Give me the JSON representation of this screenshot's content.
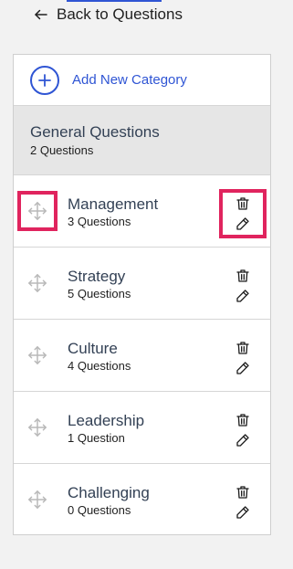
{
  "header": {
    "back_label": "Back to Questions"
  },
  "add_category": {
    "label": "Add New Category"
  },
  "general": {
    "title": "General Questions",
    "count": "2 Questions"
  },
  "categories": [
    {
      "title": "Management",
      "count": "3 Questions"
    },
    {
      "title": "Strategy",
      "count": "5 Questions"
    },
    {
      "title": "Culture",
      "count": "4 Questions"
    },
    {
      "title": "Leadership",
      "count": "1 Question"
    },
    {
      "title": "Challenging",
      "count": "0 Questions"
    }
  ],
  "colors": {
    "accent": "#2f55d4",
    "highlight": "#e0245e",
    "title_text": "#334155"
  },
  "icons": [
    "arrow-left-icon",
    "plus-icon",
    "move-icon",
    "trash-icon",
    "pencil-icon"
  ]
}
